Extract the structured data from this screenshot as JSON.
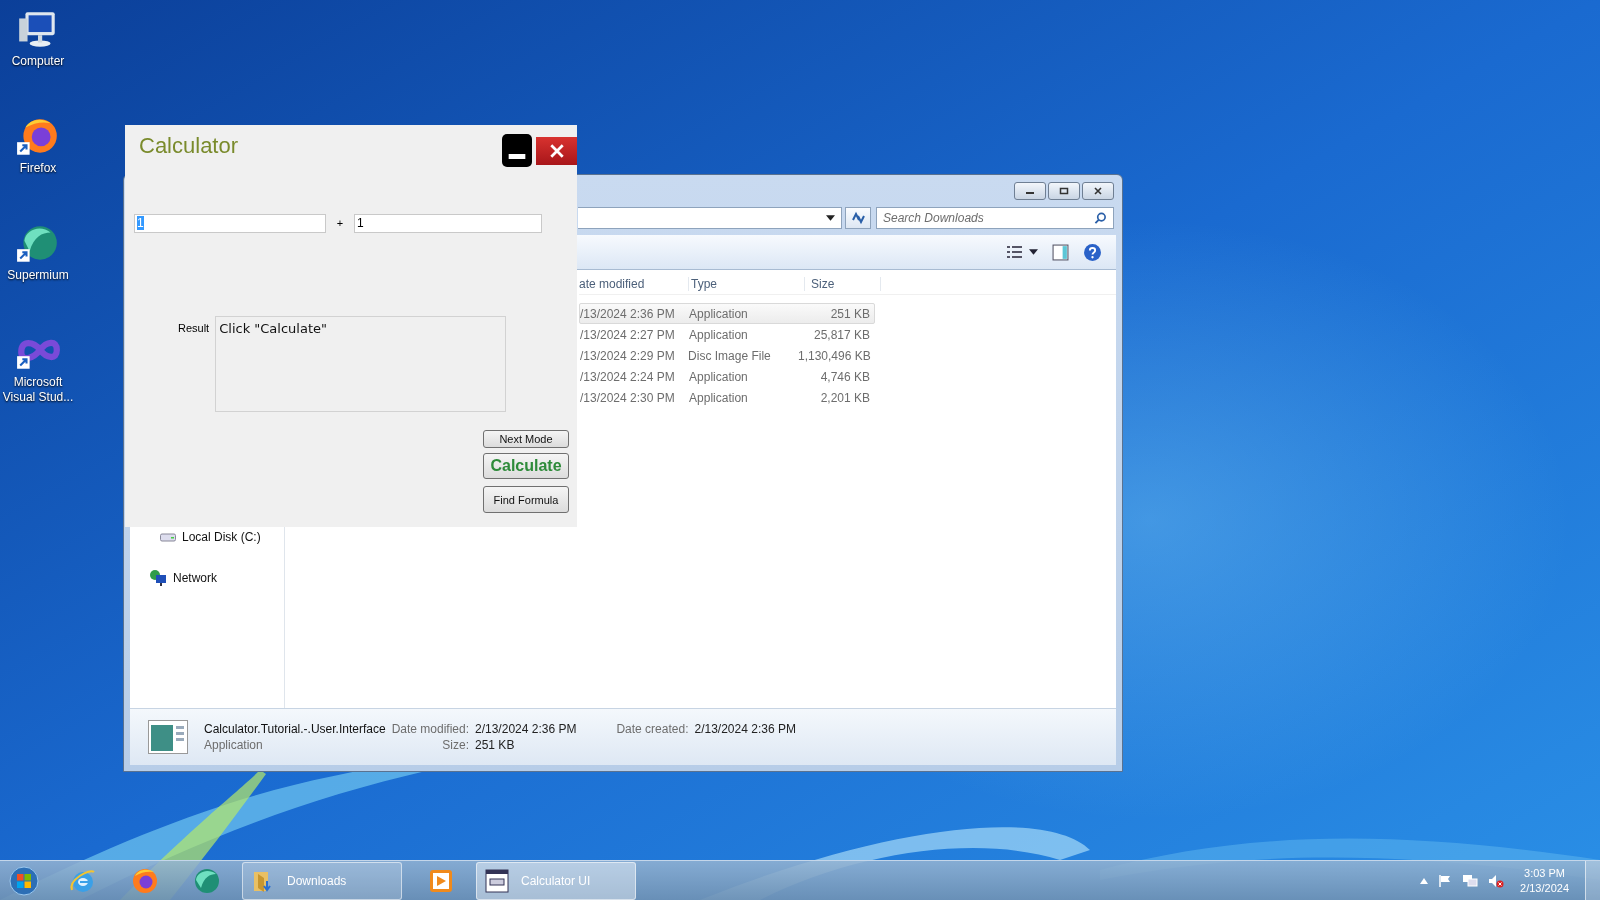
{
  "desktop_icons": [
    {
      "label": "Computer",
      "kind": "computer",
      "shortcut": false
    },
    {
      "label": "Firefox",
      "kind": "firefox",
      "shortcut": true
    },
    {
      "label": "Supermium",
      "kind": "supermium",
      "shortcut": true
    },
    {
      "label": "Microsoft Visual Stud...",
      "kind": "vs",
      "shortcut": true
    }
  ],
  "explorer": {
    "search": {
      "placeholder": "Search Downloads"
    },
    "columns": [
      "ate modified",
      "Type",
      "Size"
    ],
    "rows": [
      {
        "date": "/13/2024 2:36 PM",
        "type": "Application",
        "size": "251 KB",
        "selected": true
      },
      {
        "date": "/13/2024 2:27 PM",
        "type": "Application",
        "size": "25,817 KB",
        "selected": false
      },
      {
        "date": "/13/2024 2:29 PM",
        "type": "Disc Image File",
        "size": "1,130,496 KB",
        "selected": false
      },
      {
        "date": "/13/2024 2:24 PM",
        "type": "Application",
        "size": "4,746 KB",
        "selected": false
      },
      {
        "date": "/13/2024 2:30 PM",
        "type": "Application",
        "size": "2,201 KB",
        "selected": false
      }
    ],
    "nav": [
      {
        "label": "Local Disk (C:)",
        "kind": "drive"
      },
      {
        "label": "Network",
        "kind": "network"
      }
    ],
    "details": {
      "name": "Calculator.Tutorial.-.User.Interface",
      "type": "Application",
      "modified_label": "Date modified:",
      "modified": "2/13/2024 2:36 PM",
      "size_label": "Size:",
      "size": "251 KB",
      "created_label": "Date created:",
      "created": "2/13/2024 2:36 PM"
    }
  },
  "calculator": {
    "title": "Calculator",
    "operand_1": {
      "value": "1",
      "text_selected": true
    },
    "operator": "+",
    "operand_2": {
      "value": "1",
      "text_selected": false
    },
    "result_label": "Result",
    "result": "Click \"Calculate\"",
    "buttons": [
      {
        "label": "Next Mode",
        "kind": "plain"
      },
      {
        "label": "Calculate",
        "kind": "primary"
      },
      {
        "label": "Find Formula",
        "kind": "plain"
      }
    ]
  },
  "taskbar": {
    "items": [
      {
        "kind": "ie"
      },
      {
        "kind": "firefox"
      },
      {
        "kind": "supermium"
      },
      {
        "kind": "folder",
        "label": "Downloads",
        "selected": false
      },
      {
        "kind": "media"
      },
      {
        "kind": "calculator",
        "label": "Calculator UI",
        "selected": true
      }
    ],
    "clock": {
      "time": "3:03 PM",
      "date": "2/13/2024"
    }
  }
}
